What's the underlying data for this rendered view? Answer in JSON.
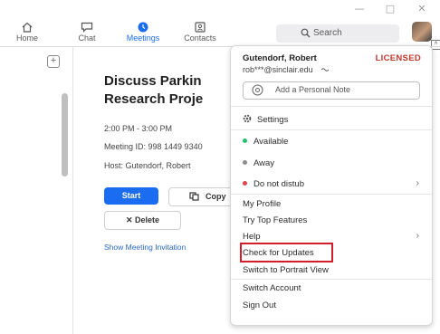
{
  "window": {
    "minimize": "—",
    "maximize": "□",
    "close": "✕"
  },
  "nav": {
    "items": [
      {
        "label": "Home",
        "icon": "home-icon"
      },
      {
        "label": "Chat",
        "icon": "chat-icon"
      },
      {
        "label": "Meetings",
        "icon": "clock-icon",
        "active": true
      },
      {
        "label": "Contacts",
        "icon": "contacts-icon"
      }
    ]
  },
  "search": {
    "label": "Search"
  },
  "meeting": {
    "title_line1": "Discuss Parkin",
    "title_line2": "Research Proje",
    "time": "2:00 PM - 3:00 PM",
    "meeting_id": "Meeting ID: 998 1449 9340",
    "host": "Host: Gutendorf, Robert",
    "start_label": "Start",
    "copy_label": "Copy",
    "delete_label": "Delete",
    "show_invitation": "Show Meeting Invitation"
  },
  "profile_menu": {
    "name": "Gutendorf, Robert",
    "license": "LICENSED",
    "email": "rob***@sinclair.edu",
    "note_placeholder": "Add a Personal Note",
    "settings": "Settings",
    "statuses": [
      {
        "label": "Available",
        "color": "#23c16b"
      },
      {
        "label": "Away",
        "color": "#8a8a8a"
      },
      {
        "label": "Do not distub",
        "color": "#e0464c"
      }
    ],
    "my_profile": "My Profile",
    "try_top_features": "Try Top Features",
    "help": "Help",
    "check_for_updates": "Check for Updates",
    "switch_portrait": "Switch to Portrait View",
    "switch_account": "Switch Account",
    "sign_out": "Sign Out",
    "highlight_color": "#d21d2b"
  },
  "colors": {
    "accent": "#1a6cf0",
    "link": "#2a67c9"
  }
}
